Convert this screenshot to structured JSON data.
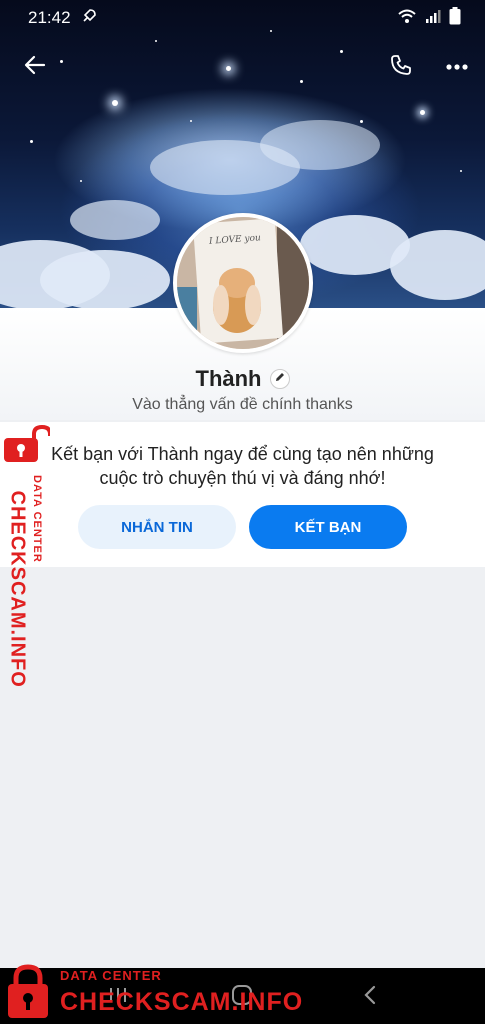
{
  "status_bar": {
    "time": "21:42"
  },
  "icons": {
    "back": "arrow-left-icon",
    "call": "phone-icon",
    "more": "more-horizontal-icon",
    "edit": "pencil-icon",
    "wifi": "wifi-icon",
    "signal": "signal-icon",
    "battery": "battery-icon",
    "rocket": "rocket-icon"
  },
  "profile": {
    "name": "Thành",
    "status": "Vào thẳng vấn đề chính thanks",
    "avatar_text": "I LOVE you"
  },
  "invite": {
    "message": "Kết bạn với Thành ngay để cùng tạo nên những cuộc trò chuyện thú vị và đáng nhớ!",
    "message_button": "NHẮN TIN",
    "add_friend_button": "KẾT BẠN"
  },
  "watermark": {
    "small": "DATA CENTER",
    "big": "CHECKSCAM.INFO"
  },
  "colors": {
    "primary": "#0a7bf0",
    "secondary_bg": "#e8f2fc",
    "watermark": "#e02020"
  }
}
